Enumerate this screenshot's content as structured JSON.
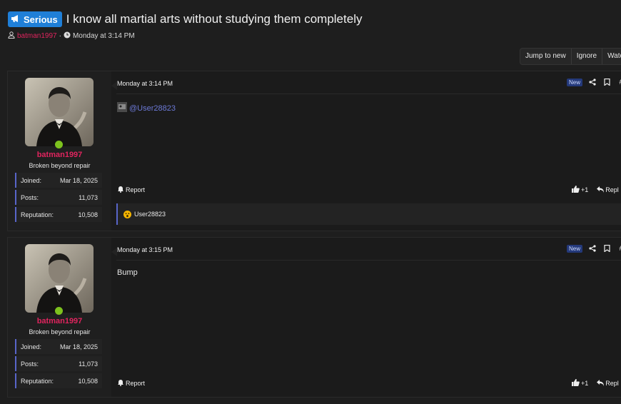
{
  "thread": {
    "prefix": "Serious",
    "title": "I know all martial arts without studying them completely",
    "author": "batman1997",
    "separator": "·",
    "date": "Monday at 3:14 PM"
  },
  "actions": [
    "Jump to new",
    "Ignore",
    "Watc"
  ],
  "posts": [
    {
      "date": "Monday at 3:14 PM",
      "badge": "New",
      "body": "@User28823",
      "username": "batman1997",
      "usertitle": "Broken beyond repair",
      "stats": {
        "joined_label": "Joined:",
        "joined": "Mar 18, 2025",
        "posts_label": "Posts:",
        "posts": "11,073",
        "rep_label": "Reputation:",
        "rep": "10,508"
      },
      "report": "Report",
      "like": "+1",
      "reply": "Repl",
      "reaction_user": "User28823"
    },
    {
      "date": "Monday at 3:15 PM",
      "badge": "New",
      "body": "Bump",
      "username": "batman1997",
      "usertitle": "Broken beyond repair",
      "stats": {
        "joined_label": "Joined:",
        "joined": "Mar 18, 2025",
        "posts_label": "Posts:",
        "posts": "11,073",
        "rep_label": "Reputation:",
        "rep": "10,508"
      },
      "report": "Report",
      "like": "+1",
      "reply": "Repl"
    }
  ],
  "colors": {
    "accent": "#5865c9",
    "username": "#e0245e",
    "prefix": "#1f7fd8",
    "online": "#7dc21e"
  }
}
